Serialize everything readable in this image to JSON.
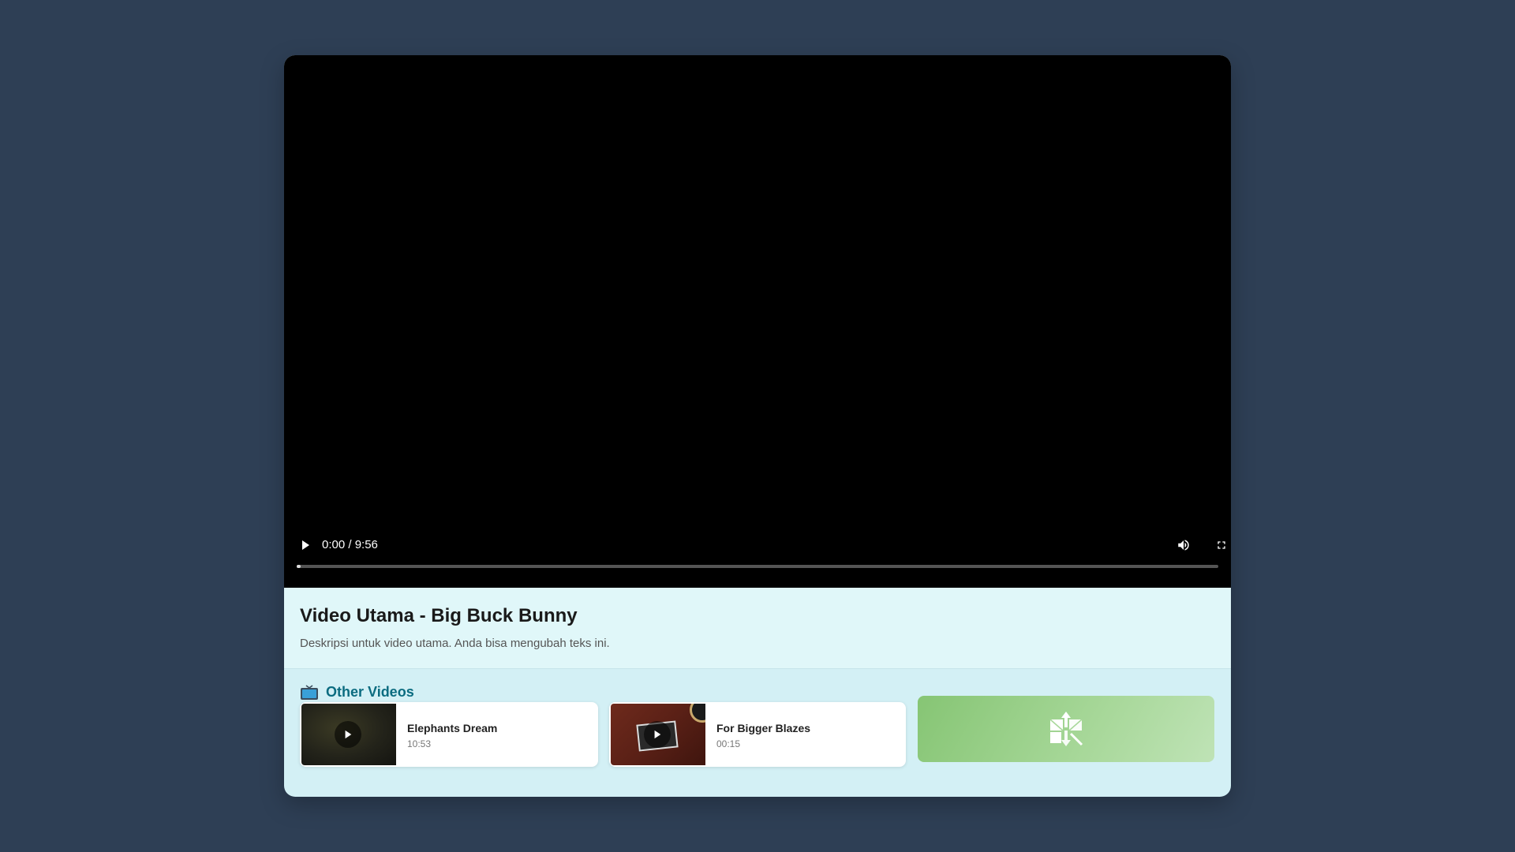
{
  "player": {
    "time_display": "0:00 / 9:56",
    "progress_fraction": 0.003
  },
  "main_video": {
    "title": "Video Utama - Big Buck Bunny",
    "description": "Deskripsi untuk video utama. Anda bisa mengubah teks ini."
  },
  "other_videos": {
    "heading": "Other Videos",
    "items": [
      {
        "title": "Elephants Dream",
        "duration": "10:53"
      },
      {
        "title": "For Bigger Blazes",
        "duration": "00:15"
      }
    ]
  },
  "colors": {
    "page_background": "#2e3f55",
    "heading_accent": "#0b6c80",
    "info_background": "#e0f7f9",
    "section_background": "#d3f0f5"
  }
}
